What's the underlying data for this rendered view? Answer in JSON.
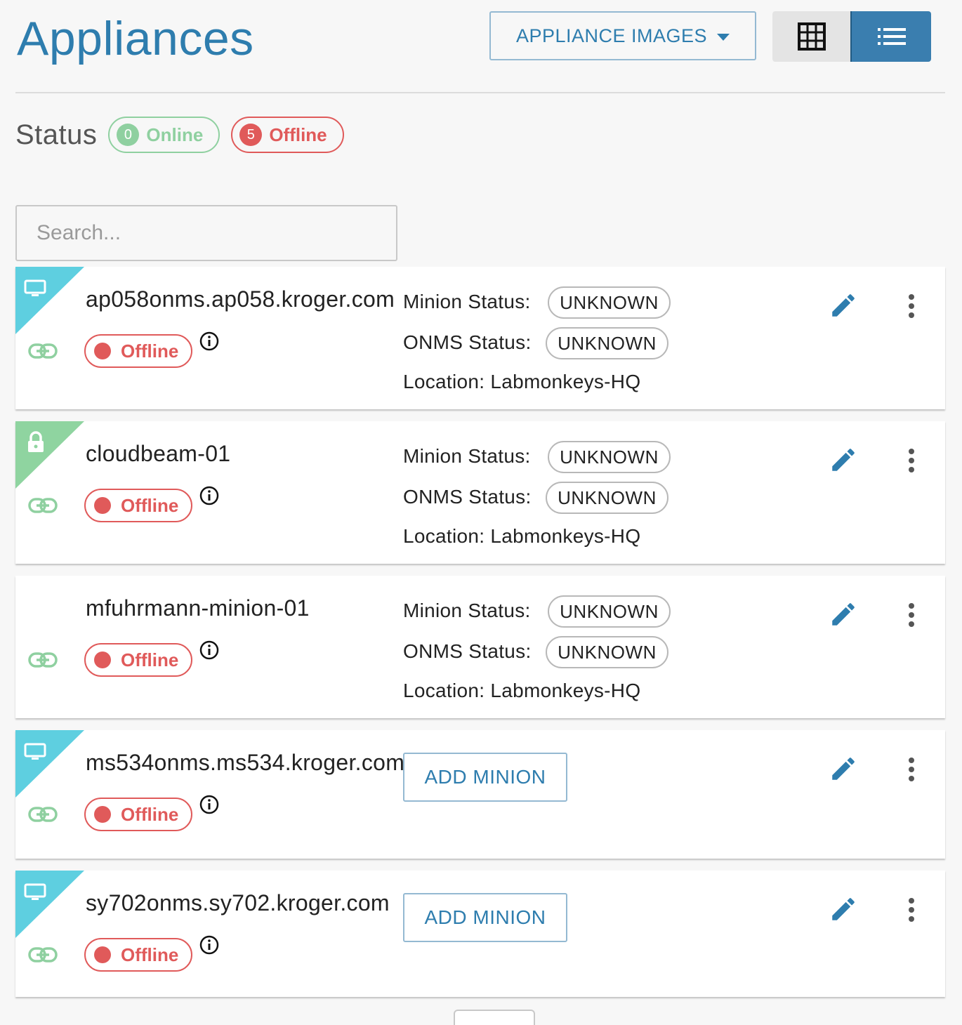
{
  "header": {
    "title": "Appliances",
    "images_button": "APPLIANCE IMAGES",
    "view_modes": [
      "grid-icon",
      "list-icon"
    ],
    "active_view": "list"
  },
  "status": {
    "label": "Status",
    "online": {
      "count": "0",
      "label": "Online",
      "color": "#8fd0a0"
    },
    "offline": {
      "count": "5",
      "label": "Offline",
      "color": "#e05a5a"
    }
  },
  "search": {
    "placeholder": "Search...",
    "value": ""
  },
  "appliances": [
    {
      "name": "ap058onms.ap058.kroger.com",
      "corner": "monitor-icon",
      "corner_color": "#5ecfe0",
      "status": "Offline",
      "minion_label": "Minion Status:",
      "minion_status": "UNKNOWN",
      "onms_label": "ONMS Status:",
      "onms_status": "UNKNOWN",
      "location": "Location: Labmonkeys-HQ"
    },
    {
      "name": "cloudbeam-01",
      "corner": "lock-icon",
      "corner_color": "#8fd4a0",
      "status": "Offline",
      "minion_label": "Minion Status:",
      "minion_status": "UNKNOWN",
      "onms_label": "ONMS Status:",
      "onms_status": "UNKNOWN",
      "location": "Location: Labmonkeys-HQ"
    },
    {
      "name": "mfuhrmann-minion-01",
      "corner": "",
      "corner_color": "",
      "status": "Offline",
      "minion_label": "Minion Status:",
      "minion_status": "UNKNOWN",
      "onms_label": "ONMS Status:",
      "onms_status": "UNKNOWN",
      "location": "Location: Labmonkeys-HQ"
    },
    {
      "name": "ms534onms.ms534.kroger.com",
      "corner": "monitor-icon",
      "corner_color": "#5ecfe0",
      "status": "Offline",
      "add_minion": "ADD MINION"
    },
    {
      "name": "sy702onms.sy702.kroger.com",
      "corner": "monitor-icon",
      "corner_color": "#5ecfe0",
      "status": "Offline",
      "add_minion": "ADD MINION"
    }
  ]
}
